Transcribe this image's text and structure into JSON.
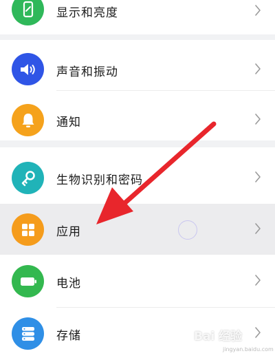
{
  "settings": {
    "items": [
      {
        "label": "显示和亮度",
        "icon": "display-phone-icon",
        "color": "#2fb85a"
      },
      {
        "label": "声音和振动",
        "icon": "speaker-icon",
        "color": "#2f55e6"
      },
      {
        "label": "通知",
        "icon": "bell-icon",
        "color": "#f5a21c"
      },
      {
        "label": "生物识别和密码",
        "icon": "key-icon",
        "color": "#20b3b8"
      },
      {
        "label": "应用",
        "icon": "apps-grid-icon",
        "color": "#f59c1c"
      },
      {
        "label": "电池",
        "icon": "battery-icon",
        "color": "#33b84f"
      },
      {
        "label": "存储",
        "icon": "storage-icon",
        "color": "#2f8fe6"
      }
    ]
  },
  "watermark": {
    "text": "Bai 经验",
    "sub": "jingyan.baidu.com"
  },
  "annotation": {
    "arrow_color": "#e8262c"
  }
}
